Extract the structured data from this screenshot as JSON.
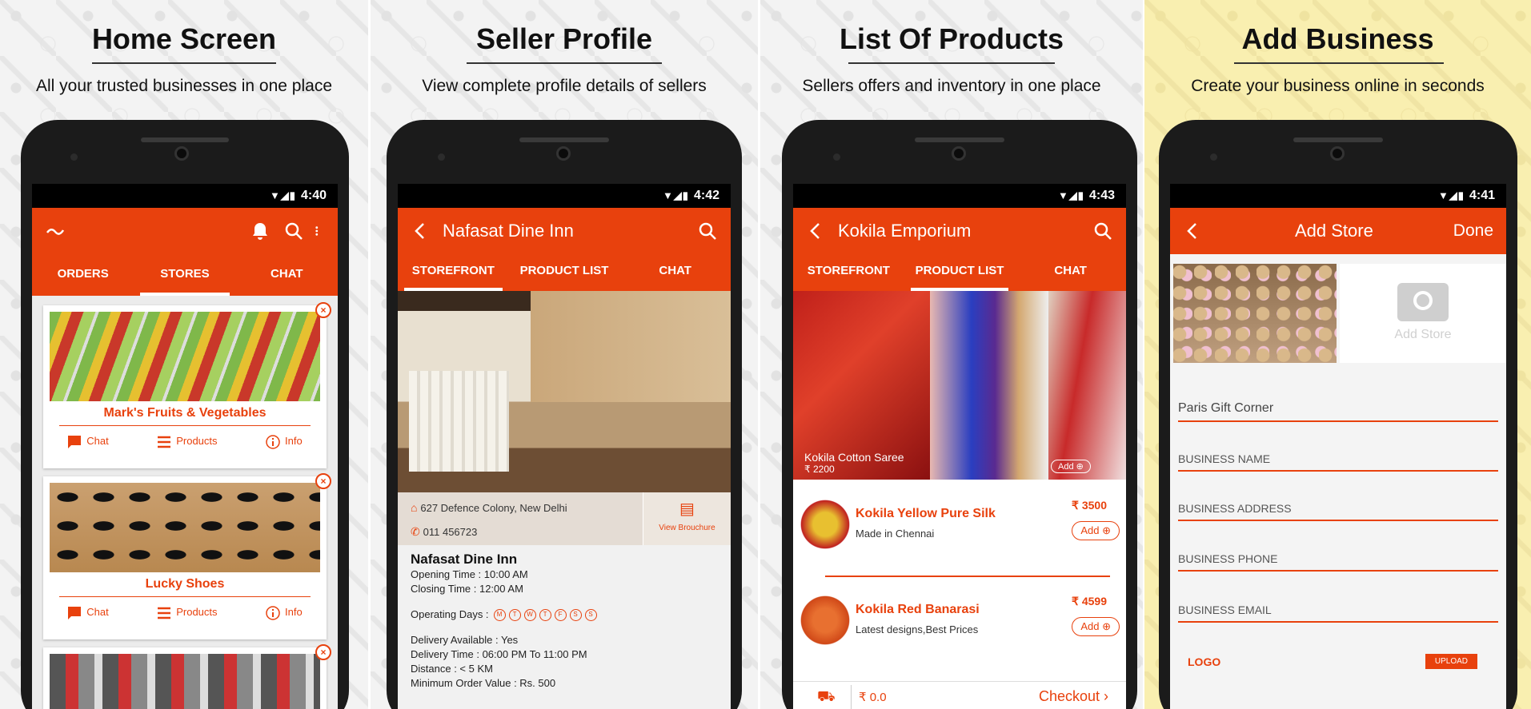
{
  "colors": {
    "accent": "#e8410d"
  },
  "panels": [
    {
      "title": "Home Screen",
      "subtitle": "All your trusted businesses in one place",
      "time": "4:40"
    },
    {
      "title": "Seller Profile",
      "subtitle": "View complete profile details of sellers",
      "time": "4:42"
    },
    {
      "title": "List Of Products",
      "subtitle": "Sellers offers and inventory in one place",
      "time": "4:43"
    },
    {
      "title": "Add Business",
      "subtitle": "Create your business online in seconds",
      "time": "4:41"
    }
  ],
  "home": {
    "tabs": [
      "ORDERS",
      "STORES",
      "CHAT"
    ],
    "stores": [
      {
        "name": "Mark's Fruits & Vegetables"
      },
      {
        "name": "Lucky Shoes"
      }
    ],
    "actions": {
      "chat": "Chat",
      "products": "Products",
      "info": "Info"
    },
    "close": "×"
  },
  "seller": {
    "title": "Nafasat Dine Inn",
    "tabs": [
      "STOREFRONT",
      "PRODUCT LIST",
      "CHAT"
    ],
    "address": "627 Defence Colony, New Delhi",
    "phone": "011 456723",
    "brochure": "View Brouchure",
    "name": "Nafasat Dine Inn",
    "opening": "Opening Time : 10:00 AM",
    "closing": "Closing Time : 12:00 AM",
    "operating_label": "Operating Days :",
    "days": [
      "M",
      "T",
      "W",
      "T",
      "F",
      "S",
      "S"
    ],
    "delivery_available": "Delivery Available : Yes",
    "delivery_time": "Delivery Time : 06:00 PM To 11:00 PM",
    "distance": "Distance : < 5 KM",
    "min_order": "Minimum Order Value : Rs. 500"
  },
  "products": {
    "title": "Kokila Emporium",
    "tabs": [
      "STOREFRONT",
      "PRODUCT LIST",
      "CHAT"
    ],
    "banner_name": "Kokila Cotton Saree",
    "banner_price": "₹ 2200",
    "banner_add": "Add",
    "items": [
      {
        "name": "Kokila Yellow Pure Silk",
        "desc": "Made in Chennai",
        "price": "₹ 3500",
        "add": "Add"
      },
      {
        "name": "Kokila Red Banarasi",
        "desc": "Latest designs,Best Prices",
        "price": "₹ 4599",
        "add": "Add"
      }
    ],
    "total": "₹ 0.0",
    "checkout": "Checkout"
  },
  "add": {
    "title": "Add Store",
    "done": "Done",
    "add_store": "Add Store",
    "store_name": "Paris Gift Corner",
    "fields": [
      "BUSINESS NAME",
      "BUSINESS ADDRESS",
      "BUSINESS PHONE",
      "BUSINESS EMAIL"
    ],
    "logo": "LOGO",
    "upload": "UPLOAD"
  }
}
